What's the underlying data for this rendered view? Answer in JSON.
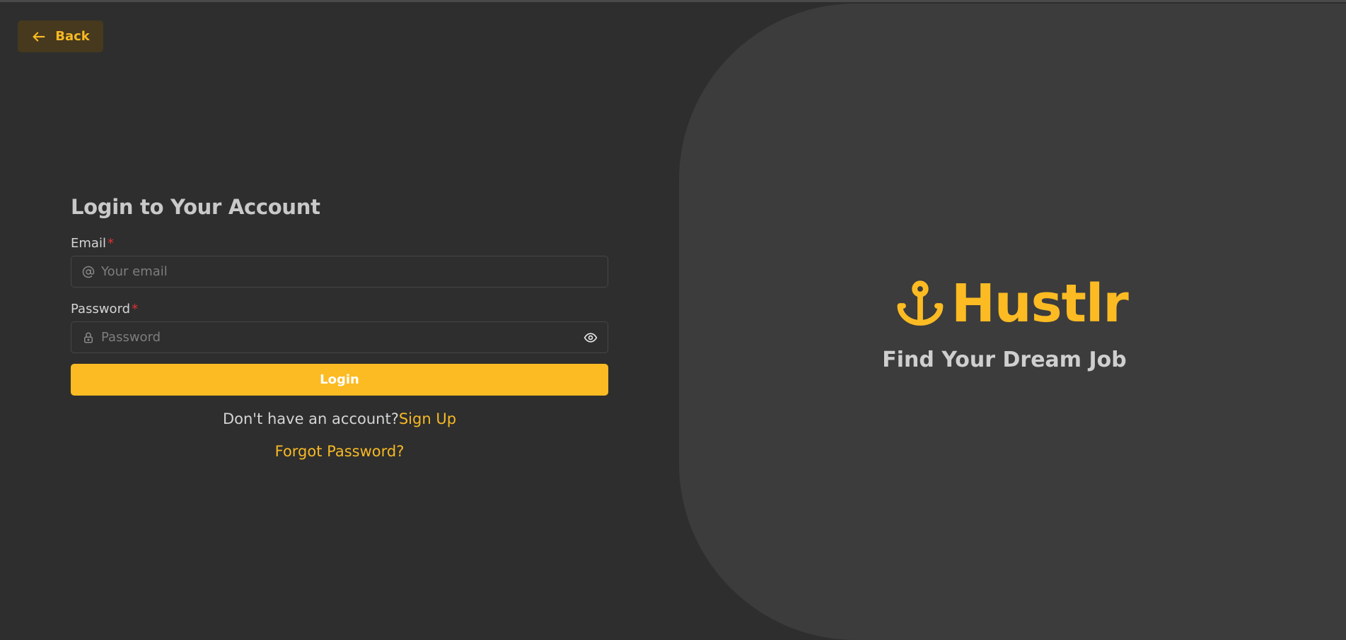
{
  "back": {
    "label": "Back",
    "icon": "arrow-left-icon"
  },
  "login": {
    "title": "Login to Your Account",
    "email_label": "Email",
    "email_placeholder": "Your email",
    "email_value": "",
    "password_label": "Password",
    "password_placeholder": "Password",
    "password_value": "",
    "required_marker": "*",
    "submit_label": "Login",
    "no_account_text": "Don't have an account?",
    "signup_label": "Sign Up",
    "forgot_label": "Forgot Password?"
  },
  "hero": {
    "brand_name": "Hustlr",
    "brand_icon": "anchor-icon",
    "tagline": "Find Your Dream Job"
  },
  "colors": {
    "accent": "#fcbb22",
    "background": "#2e2e2e",
    "panel": "#3c3c3c",
    "required": "#e03131"
  }
}
